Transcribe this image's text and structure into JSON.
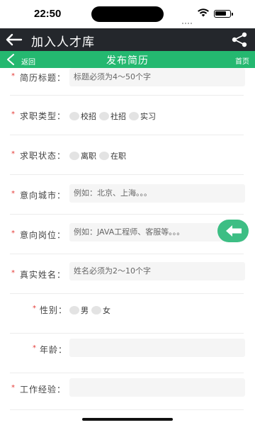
{
  "status_bar": {
    "time": "22:50"
  },
  "app_bar": {
    "title": "加入人才库"
  },
  "sub_bar": {
    "back_label": "返回",
    "title": "发布简历",
    "home_label": "首页"
  },
  "form": {
    "resume_title": {
      "label": "简历标题：",
      "placeholder": "标题必须为4～50个字"
    },
    "job_type": {
      "label": "求职类型：",
      "options": [
        "校招",
        "社招",
        "实习"
      ]
    },
    "job_status": {
      "label": "求职状态：",
      "options": [
        "离职",
        "在职"
      ]
    },
    "city": {
      "label": "意向城市：",
      "placeholder": "例如：北京、上海。。。"
    },
    "position": {
      "label": "意向岗位：",
      "placeholder": "例如：JAVA工程师、客服等。。。"
    },
    "real_name": {
      "label": "真实姓名：",
      "placeholder": "姓名必须为2～10个字"
    },
    "gender": {
      "label": "性别：",
      "options": [
        "男",
        "女"
      ]
    },
    "age": {
      "label": "年龄：",
      "value": ""
    },
    "experience": {
      "label": "工作经验：",
      "value": ""
    }
  },
  "colors": {
    "accent": "#24b870",
    "app_bar": "#24272c",
    "required": "#e53935"
  }
}
